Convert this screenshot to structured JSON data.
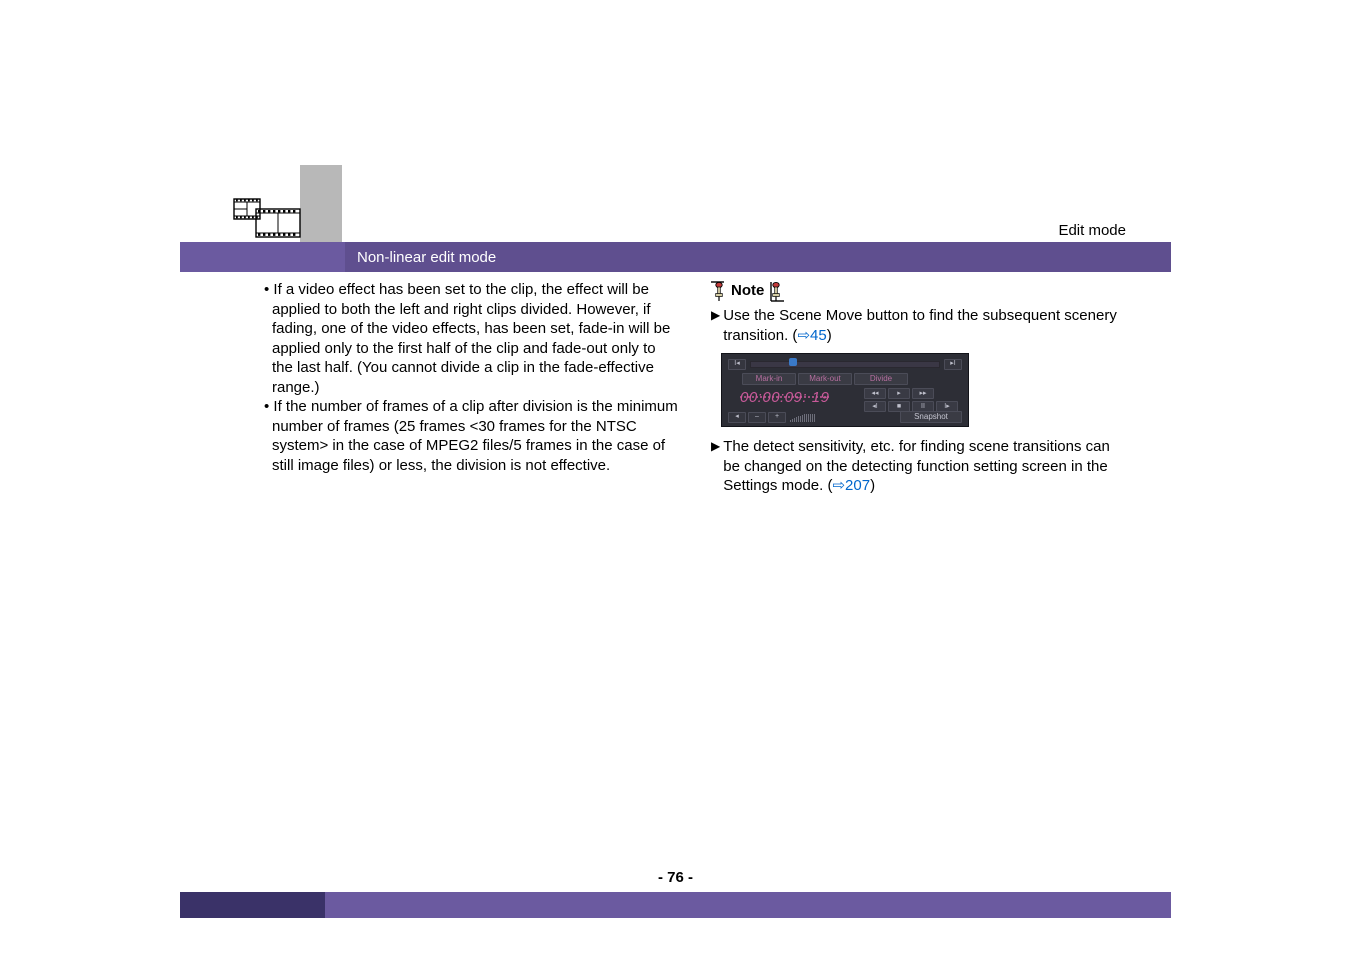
{
  "header": {
    "edit_mode": "Edit mode",
    "banner_title": "Non-linear edit mode"
  },
  "left_column": {
    "para1": "• If a video effect has been set to the clip, the effect will be applied to both the left and right clips divided. However, if fading, one of the video effects, has been set, fade-in will be applied only to the first half of the clip and fade-out only to the last half. (You cannot divide a clip in the fade-effective range.)",
    "para2": "• If the number of frames of a clip after division is the minimum number of frames (25 frames <30 frames for the NTSC system>  in the case of MPEG2 files/5 frames in the case of still image files) or less, the division is not effective."
  },
  "right_column": {
    "note_label": "Note",
    "line1_pre": "Use the Scene Move button to find the subsequent scenery transition. (",
    "line1_link": "⇨45",
    "line1_post": ")",
    "line2_pre": "The detect sensitivity, etc. for finding scene transitions can be changed on the detecting function setting screen in the Settings mode. (",
    "line2_link": "⇨207",
    "line2_post": ")"
  },
  "screenshot": {
    "mark_in": "Mark-in",
    "mark_out": "Mark-out",
    "divide": "Divide",
    "timecode": "00:00:09: 19",
    "snapshot": "Snapshot"
  },
  "page_number": "- 76 -"
}
